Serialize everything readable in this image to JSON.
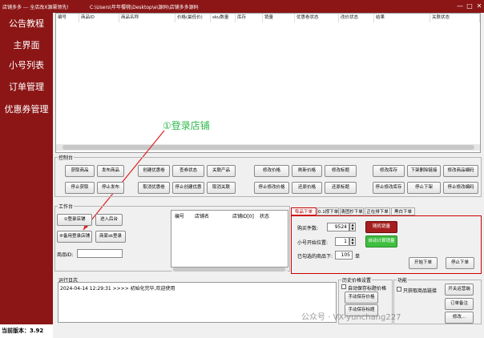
{
  "window": {
    "title_left": "店铺多多 --- 全店改X源渠领先!",
    "title_path": "C:\\Users\\年年樱桃\\Desktop\\e\\源码\\店铺多多源码",
    "minimize": "—",
    "maximize": "□",
    "close": "✕"
  },
  "sidebar": {
    "items": [
      {
        "label": "公告教程"
      },
      {
        "label": "主界面"
      },
      {
        "label": "小号列表"
      },
      {
        "label": "订单管理"
      },
      {
        "label": "优惠券管理"
      }
    ],
    "version": "当前版本：3.92"
  },
  "grid": {
    "columns": [
      "编号",
      "商品ID",
      "商品名称",
      "价格(最低价)",
      "sku数量",
      "库存",
      "销量",
      "优惠卷状态",
      "改价状态",
      "结果",
      "关联状态"
    ]
  },
  "annotation": {
    "text": "①登录店铺",
    "color": "#2db84a",
    "arrow_color": "#e02020"
  },
  "control_panel": {
    "title": "控制台",
    "row1": [
      "获取商品",
      "发布商品",
      "创建优惠卷",
      "查券状态",
      "关联产品",
      "修改价格",
      "刷新价格",
      "修改标题",
      "修改库存",
      "下架删除链接",
      "修改商品编码"
    ],
    "row2": [
      "停止获取",
      "停止发布",
      "取消优惠卷",
      "停止创建优惠",
      "取消关联",
      "停止修改价格",
      "还原价格",
      "还原标题",
      "停止修改库存",
      "停止下架",
      "停止修改编码"
    ]
  },
  "workbench": {
    "title": "工作台",
    "btn_login": "①登录店铺",
    "btn_enter": "进入后台",
    "btn_coupon_login": "⑥备用登录店铺",
    "btn_sub_login": "商家sk登录",
    "goods_id_label": "商品ID:",
    "shop_columns": [
      "编号",
      "店铺名",
      "店铺ID[0]",
      "状态"
    ]
  },
  "tabs": [
    {
      "label": "嘭品下单",
      "active": true
    },
    {
      "label": "0.1撑下单",
      "active": false
    },
    {
      "label": "清团抄下单",
      "active": false
    },
    {
      "label": "正在排下单",
      "active": false
    },
    {
      "label": "黑白下单",
      "active": false
    }
  ],
  "order_panel": {
    "buy_qty_label": "购买件数:",
    "buy_qty_value": "9524",
    "random_btn": "随机销量",
    "sub_pos_label": "小号开始位置:",
    "sub_pos_value": "1",
    "auto_calc_btn": "自动计算销量",
    "done_label": "已勾选的商品下:",
    "done_value": "105",
    "done_unit": "单",
    "start_btn": "开始下单",
    "stop_btn": "停止下单",
    "red_color": "#a61e1e",
    "green_color": "#3fbf3f"
  },
  "log": {
    "title": "运行日志",
    "line": "2024-04-14 12:29:31 >>>> 初始化完毕,欢迎使用"
  },
  "history": {
    "title": "历史价格设置",
    "auto_save_label": "自动保存标题价格",
    "manual_save_price": "手动保存价格",
    "manual_save_title": "手动保存标题"
  },
  "function": {
    "title": "功能",
    "only_label": "只获取商品链接",
    "btn_run_more": "开关运营端",
    "btn_order_remark": "订单备注",
    "btn_extra": "修改..."
  },
  "watermark": "公众号 · VX-yunchang227"
}
